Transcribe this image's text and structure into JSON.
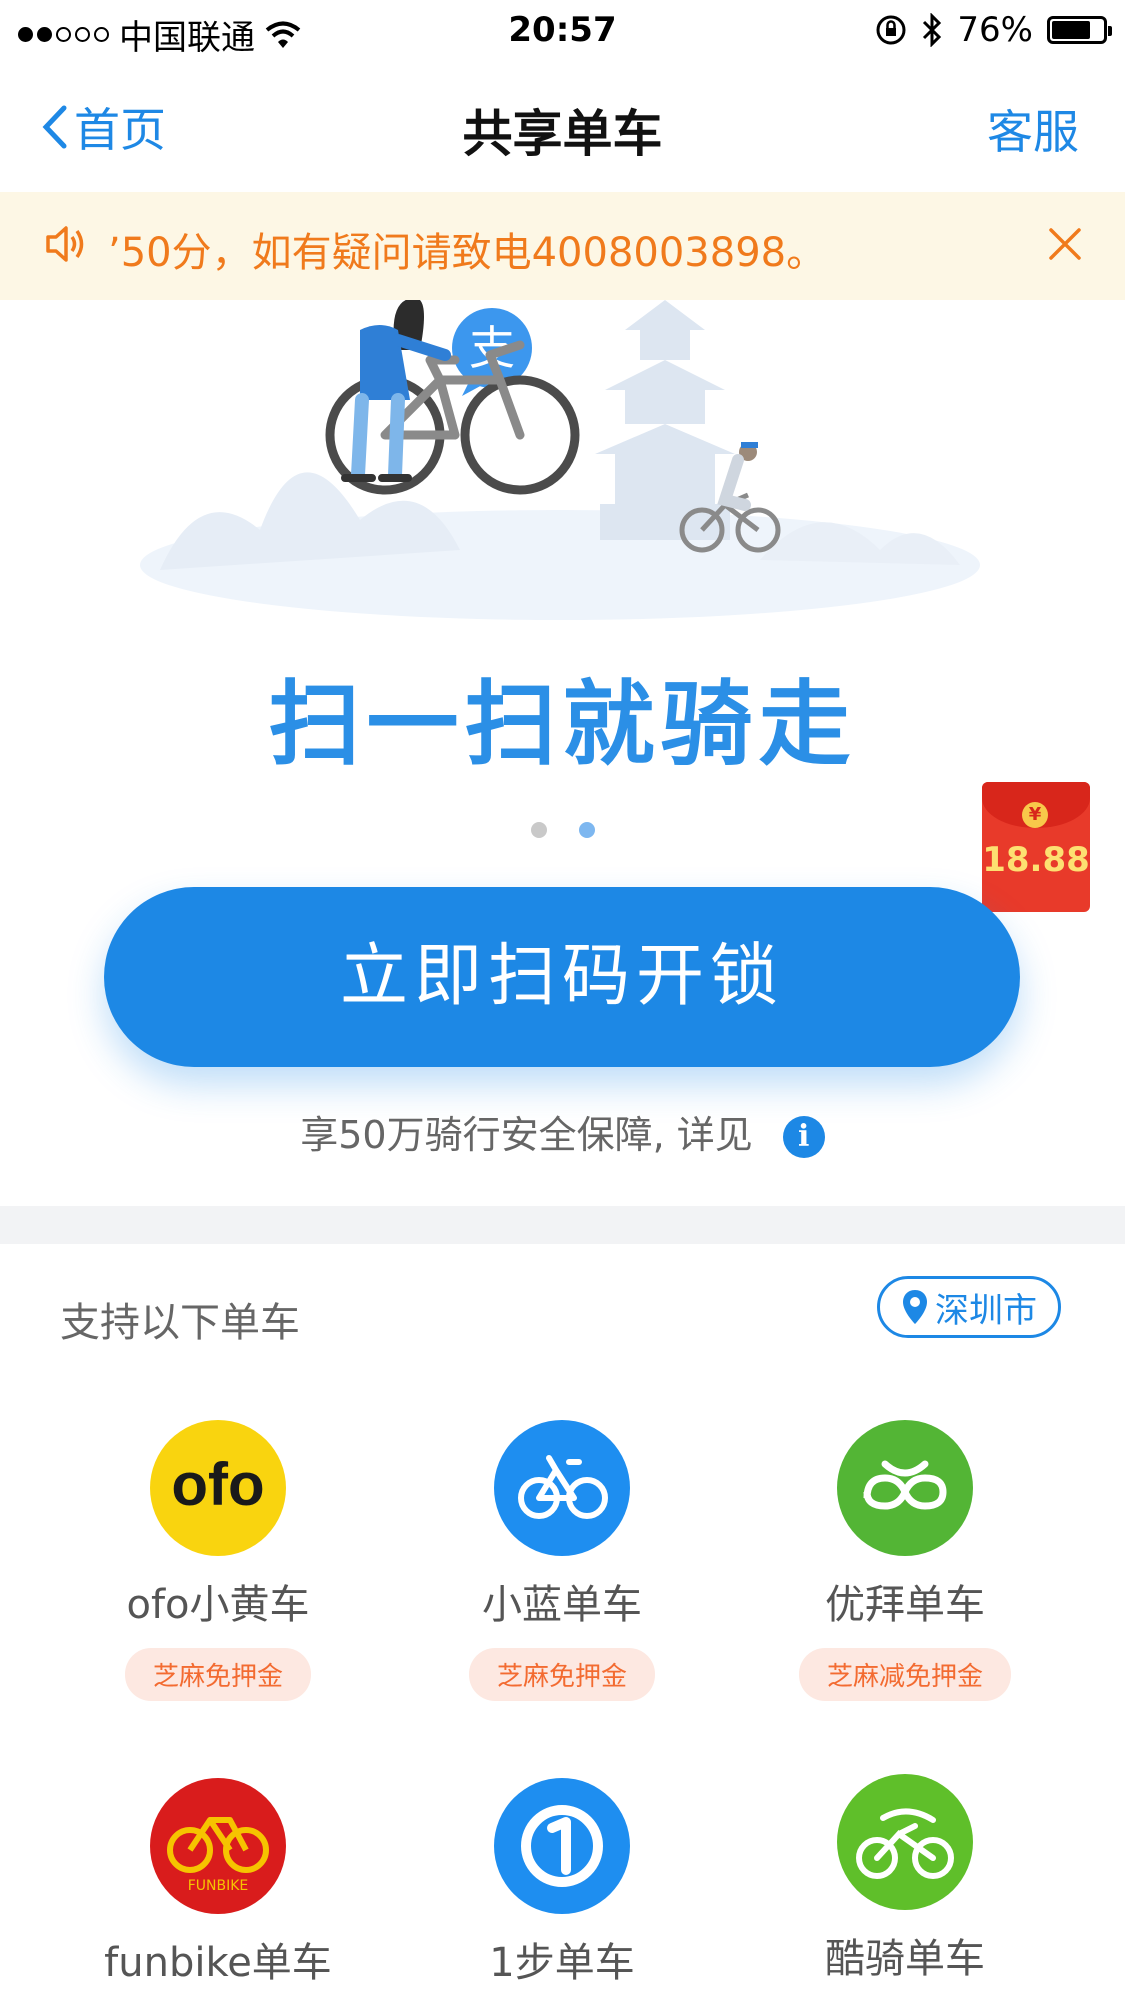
{
  "status_bar": {
    "carrier": "中国联通",
    "time": "20:57",
    "battery": "76%"
  },
  "nav": {
    "back_label": "首页",
    "title": "共享单车",
    "service_label": "客服"
  },
  "notice": {
    "text": "’50分，如有疑问请致电4008003898。"
  },
  "banner": {
    "slogan": "扫一扫就骑走",
    "alipay_char": "支"
  },
  "red_packet": {
    "amount": "18.88",
    "currency": "¥"
  },
  "cta": {
    "label": "立即扫码开锁"
  },
  "insurance": {
    "text": "享50万骑行安全保障, 详见",
    "info_glyph": "i"
  },
  "bikes_section": {
    "title": "支持以下单车",
    "city": "深圳市"
  },
  "bikes": [
    {
      "name": "ofo小黄车",
      "tag": "芝麻免押金",
      "logo_text": "ofo",
      "color": "#f9d40f"
    },
    {
      "name": "小蓝单车",
      "tag": "芝麻免押金",
      "color": "#1e8ef0"
    },
    {
      "name": "优拜单车",
      "tag": "芝麻减免押金",
      "color": "#53b535"
    },
    {
      "name": "funbike单车",
      "logo_text": "FUNBIKE",
      "color": "#d91c1c"
    },
    {
      "name": "1步单车",
      "color": "#1e8ef0"
    },
    {
      "name": "酷骑单车",
      "color": "#5fbf2a"
    }
  ]
}
